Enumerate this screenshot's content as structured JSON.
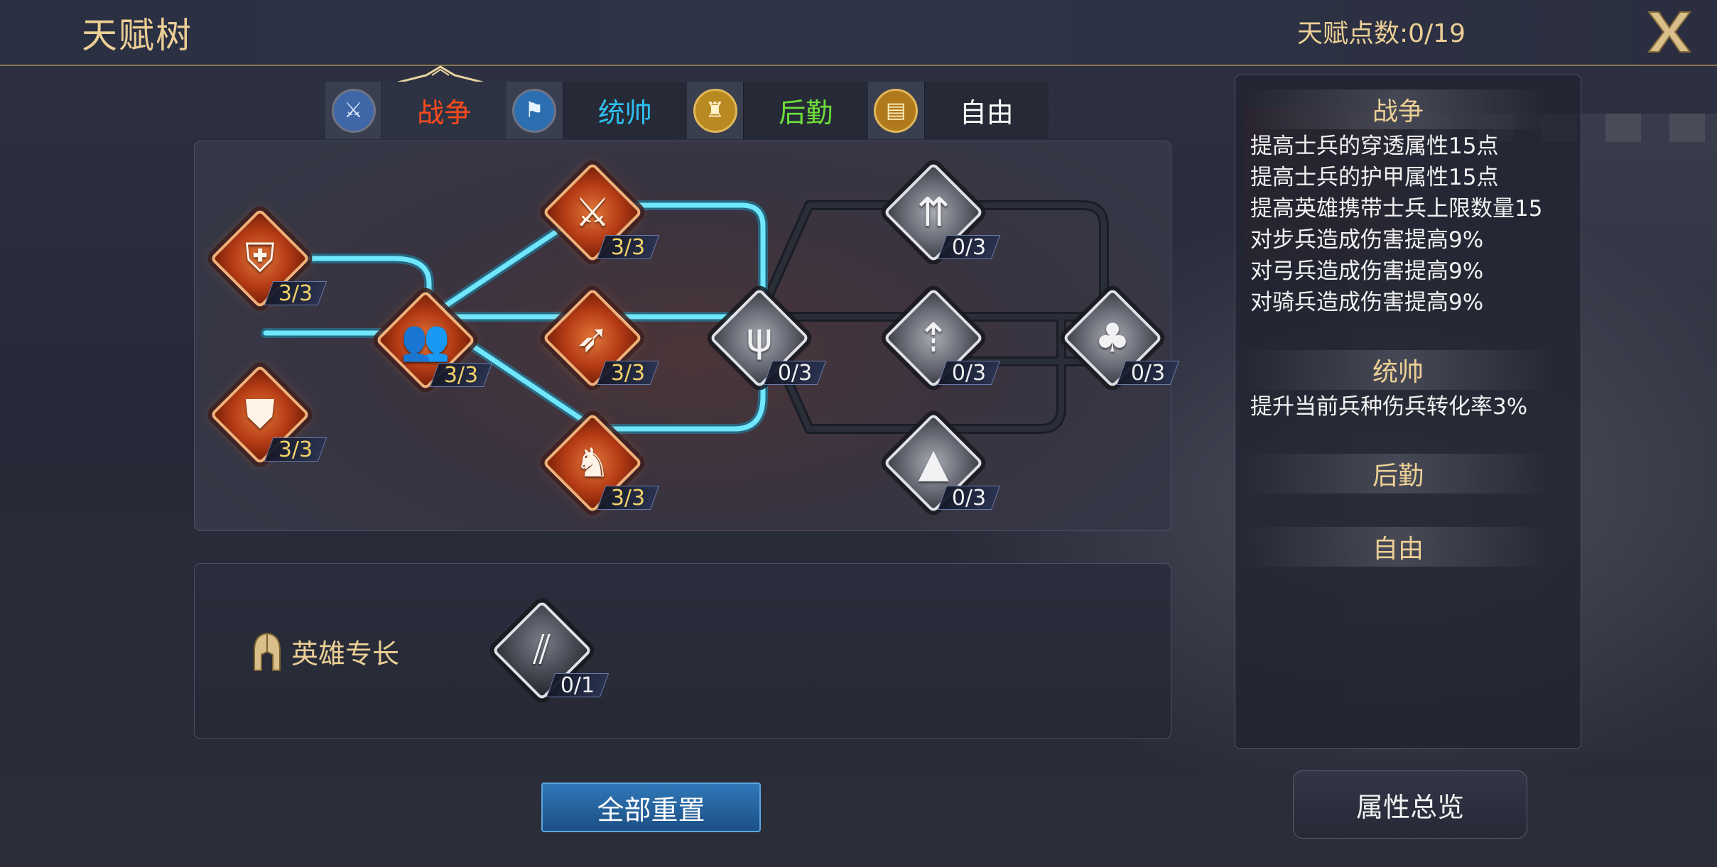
{
  "header": {
    "title": "天赋树",
    "talent_points": "天赋点数:0/19",
    "close_icon": "close-x-icon"
  },
  "tabs": [
    {
      "label": "战争",
      "icon": "warrior-icon",
      "color": "#ff4a1c",
      "active": true
    },
    {
      "label": "统帅",
      "icon": "banner-icon",
      "color": "#2ec0f0",
      "active": false
    },
    {
      "label": "后勤",
      "icon": "fortress-icon",
      "color": "#6ee03a",
      "active": false
    },
    {
      "label": "自由",
      "icon": "book-icon",
      "color": "#ffffff",
      "active": false
    }
  ],
  "tree": {
    "nodes": [
      {
        "id": "pierce",
        "icon": "broken-shield-icon",
        "count": "3/3",
        "lit": true
      },
      {
        "id": "armor",
        "icon": "armor-icon",
        "count": "3/3",
        "lit": true
      },
      {
        "id": "capacity",
        "icon": "troops-icon",
        "count": "3/3",
        "lit": true
      },
      {
        "id": "vs-infantry",
        "icon": "crossed-swords-icon",
        "count": "3/3",
        "lit": true
      },
      {
        "id": "vs-archer",
        "icon": "bow-icon",
        "count": "3/3",
        "lit": true
      },
      {
        "id": "vs-cavalry",
        "icon": "knight-icon",
        "count": "3/3",
        "lit": true
      },
      {
        "id": "grass",
        "icon": "grass-icon",
        "count": "0/3",
        "lit": false
      },
      {
        "id": "desert",
        "icon": "cactus-icon",
        "count": "0/3",
        "lit": false
      },
      {
        "id": "plains",
        "icon": "hill-icon",
        "count": "0/3",
        "lit": false
      },
      {
        "id": "mountain",
        "icon": "mountain-icon",
        "count": "0/3",
        "lit": false
      },
      {
        "id": "forest",
        "icon": "forest-icon",
        "count": "0/3",
        "lit": false
      }
    ],
    "link_active": "#3fd6ff",
    "link_inactive": "#22262f"
  },
  "specialty": {
    "label": "英雄专长",
    "icon": "spartan-helmet-icon",
    "node_icon": "claw-slash-icon",
    "count": "0/1"
  },
  "reset_button": "全部重置",
  "panel": {
    "sections": [
      {
        "title": "战争",
        "lines": [
          "提高士兵的穿透属性15点",
          "提高士兵的护甲属性15点",
          "提高英雄携带士兵上限数量15",
          "对步兵造成伤害提高9%",
          "对弓兵造成伤害提高9%",
          "对骑兵造成伤害提高9%"
        ]
      },
      {
        "title": "统帅",
        "lines": [
          "提升当前兵种伤兵转化率3%"
        ]
      },
      {
        "title": "后勤",
        "lines": []
      },
      {
        "title": "自由",
        "lines": []
      }
    ]
  },
  "overview_button": "属性总览"
}
